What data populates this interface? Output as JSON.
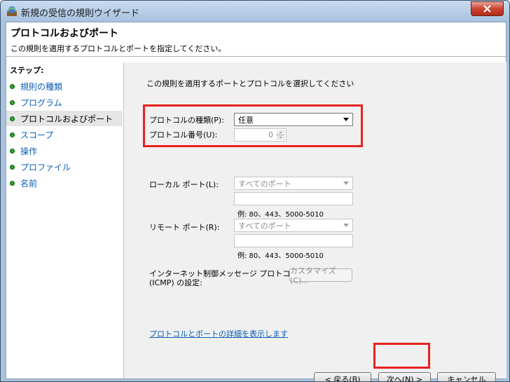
{
  "window": {
    "title": "新規の受信の規則ウイザード"
  },
  "header": {
    "title": "プロトコルおよびポート",
    "subtitle": "この規則を適用するプロトコルとポートを指定してください。"
  },
  "steps": {
    "title": "ステップ:",
    "items": [
      {
        "label": "規則の種類"
      },
      {
        "label": "プログラム"
      },
      {
        "label": "プロトコルおよびポート"
      },
      {
        "label": "スコープ"
      },
      {
        "label": "操作"
      },
      {
        "label": "プロファイル"
      },
      {
        "label": "名前"
      }
    ]
  },
  "main": {
    "instruction": "この規則を適用するポートとプロトコルを選択してください",
    "protocol_type_label": "プロトコルの種類(P):",
    "protocol_type_value": "任意",
    "protocol_number_label": "プロトコル番号(U):",
    "protocol_number_value": "0",
    "local_port_label": "ローカル ポート(L):",
    "local_port_value": "すべてのポート",
    "local_port_example": "例: 80、443、5000-5010",
    "remote_port_label": "リモート ポート(R):",
    "remote_port_value": "すべてのポート",
    "remote_port_example": "例: 80、443、5000-5010",
    "icmp_label_1": "インターネット制御メッセージ プロトコル",
    "icmp_label_2": "(ICMP) の設定:",
    "customize_button": "カスタマイズ(C)...",
    "details_link": "プロトコルとポートの詳細を表示します"
  },
  "footer": {
    "back_button": "< 戻る(B)",
    "next_button": "次へ(N) >",
    "cancel_button": "キャンセル"
  },
  "colors": {
    "highlight": "#e8221e",
    "link": "#0b5eb4",
    "step_dot": "#2f9d2c"
  }
}
